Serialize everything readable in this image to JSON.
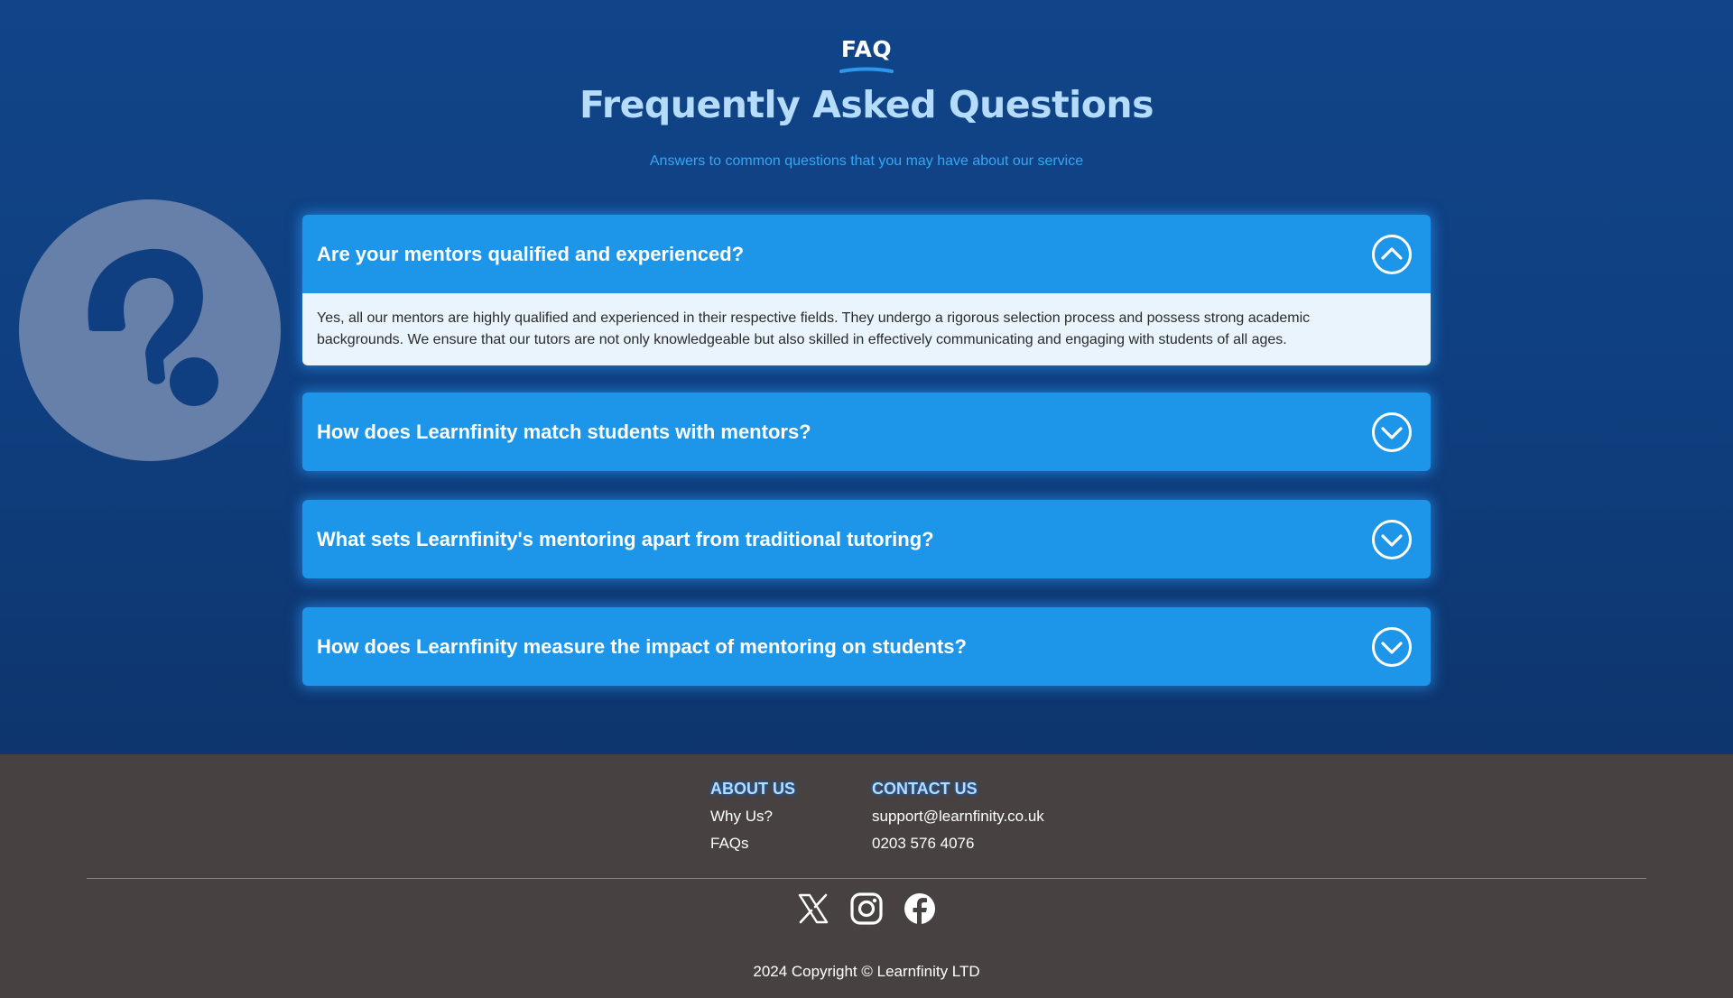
{
  "faq_header": {
    "eyebrow": "FAQ",
    "title": "Frequently Asked Questions",
    "subtitle": "Answers to common questions that you may have about our service"
  },
  "illustration": {
    "icon": "question-mark-icon"
  },
  "faq_items": [
    {
      "question": "Are your mentors qualified and experienced?",
      "answer": "Yes, all our mentors are highly qualified and experienced in their respective fields. They undergo a rigorous selection process and possess strong academic backgrounds. We ensure that our tutors are not only knowledgeable but also skilled in effectively communicating and engaging with students of all ages.",
      "expanded": true
    },
    {
      "question": "How does Learnfinity match students with mentors?",
      "answer": "",
      "expanded": false
    },
    {
      "question": "What sets Learnfinity's mentoring apart from traditional tutoring?",
      "answer": "",
      "expanded": false
    },
    {
      "question": "How does Learnfinity measure the impact of mentoring on students?",
      "answer": "",
      "expanded": false
    }
  ],
  "footer": {
    "about": {
      "heading": "ABOUT US",
      "links": [
        "Why Us?",
        "FAQs"
      ]
    },
    "contact": {
      "heading": "CONTACT US",
      "email": "support@learnfinity.co.uk",
      "phone": "0203 576 4076"
    },
    "social": [
      "x-icon",
      "instagram-icon",
      "facebook-icon"
    ],
    "copyright": "2024 Copyright © Learnfinity LTD"
  },
  "colors": {
    "section_bg": "#104589",
    "accordion_blue": "#1d96ea",
    "answer_bg": "#e9f4fd",
    "title_light_blue": "#b5dcfb",
    "subtitle_blue": "#36a7f3",
    "footer_bg": "#474241"
  }
}
